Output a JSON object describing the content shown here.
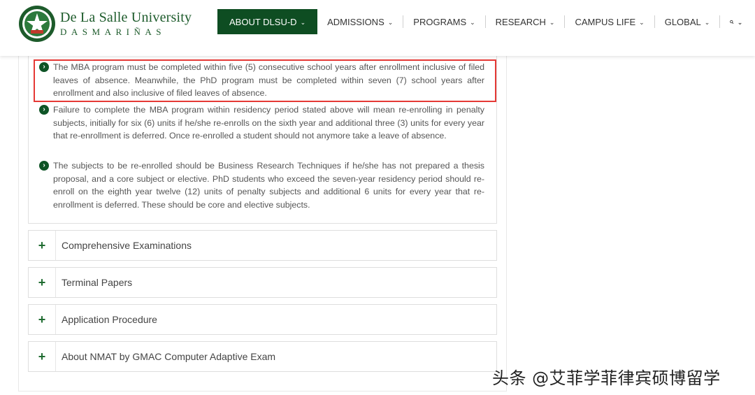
{
  "header": {
    "brand_name": "De La Salle University",
    "brand_sub": "DASMARIÑAS",
    "logo_icon": "university-seal-icon",
    "accent_color": "#0e4d22"
  },
  "nav": {
    "items": [
      {
        "label": "ABOUT DLSU-D",
        "active": true
      },
      {
        "label": "ADMISSIONS"
      },
      {
        "label": "PROGRAMS"
      },
      {
        "label": "RESEARCH"
      },
      {
        "label": "CAMPUS LIFE"
      },
      {
        "label": "GLOBAL"
      }
    ],
    "search_icon": "search-icon"
  },
  "content": {
    "bullets": [
      "The MBA program must be completed within five (5) consecutive school years after enrollment inclusive of filed leaves of absence. Meanwhile, the PhD program must be completed within seven (7) school years after enrollment and also inclusive of filed leaves of absence.",
      "Failure to complete the MBA program within residency period stated above will mean re-enrolling in penalty subjects, initially for six (6) units if he/she re-enrolls on the sixth year and additional three (3) units for every year that re-enrollment is deferred. Once re-enrolled a student should not anymore take a leave of absence.",
      "The subjects to be re-enrolled should be Business Research Techniques if he/she has not prepared a thesis proposal, and a core subject or elective. PhD students who exceed the seven-year residency period should re-enroll on the eighth year twelve (12) units of penalty subjects and additional 6 units for every year that re-enrollment is deferred. These should be core and elective subjects."
    ],
    "accordion": [
      "Comprehensive Examinations",
      "Terminal Papers",
      "Application Procedure",
      "About NMAT by GMAC Computer Adaptive Exam"
    ]
  },
  "watermark": "头条 @艾菲学菲律宾硕博留学"
}
